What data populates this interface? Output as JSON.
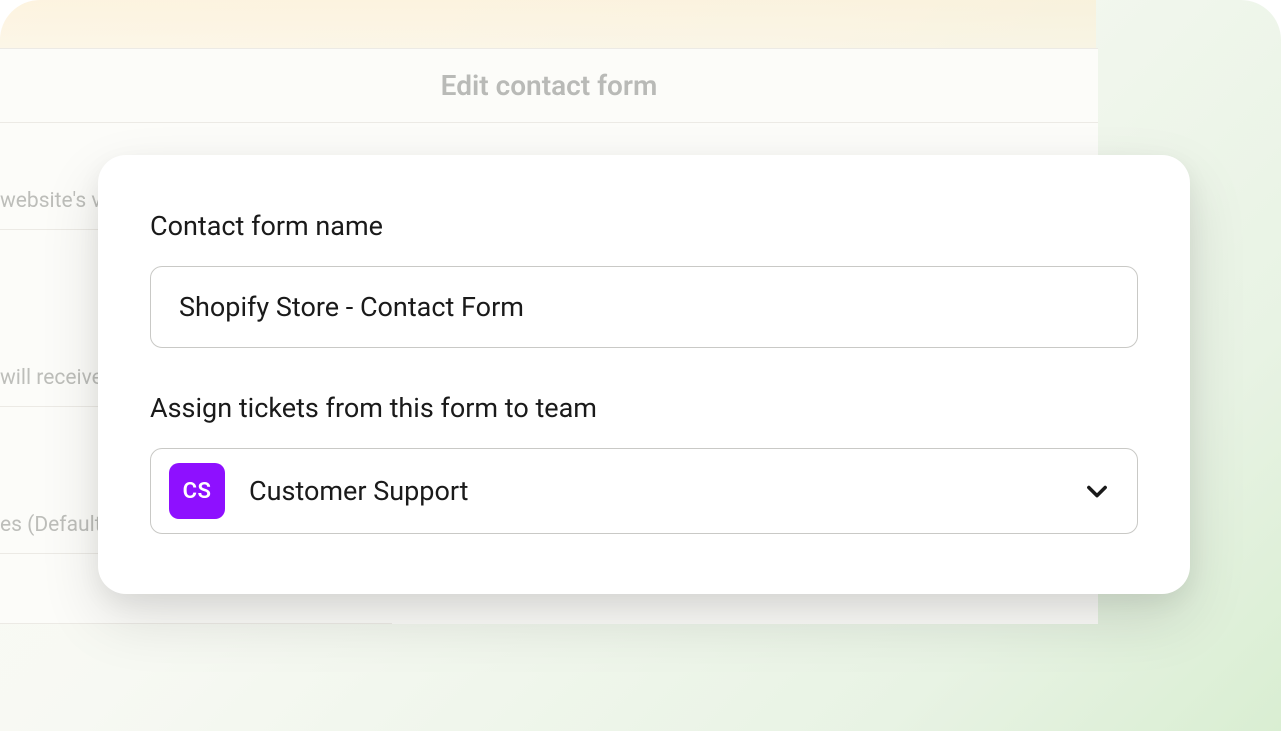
{
  "background": {
    "header_title": "Edit contact form",
    "row1_text": "website's v",
    "row2_text": "will receive",
    "row3_text": "es (Default"
  },
  "modal": {
    "name_field": {
      "label": "Contact form name",
      "value": "Shopify Store - Contact Form"
    },
    "team_field": {
      "label": "Assign tickets from this form to team",
      "badge_text": "CS",
      "selected_value": "Customer Support"
    }
  },
  "colors": {
    "accent_purple": "#8e10ff"
  }
}
